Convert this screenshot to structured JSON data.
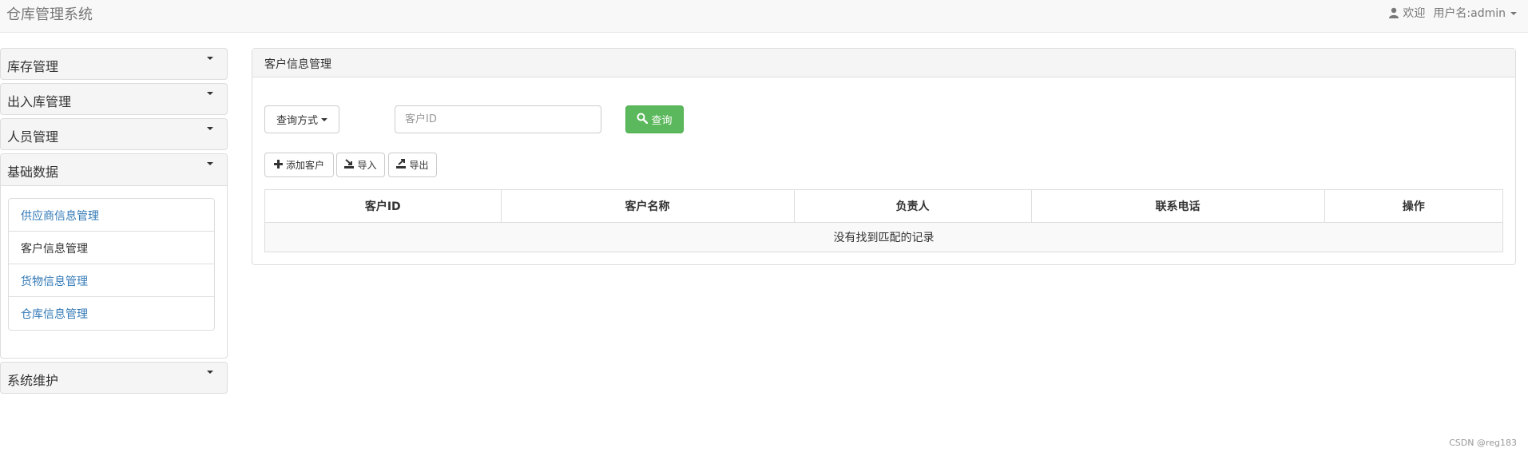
{
  "app": {
    "title": "仓库管理系统",
    "welcome": "欢迎",
    "user_label": "用户名:admin"
  },
  "sidebar": {
    "sections": [
      {
        "label": "库存管理"
      },
      {
        "label": "出入库管理"
      },
      {
        "label": "人员管理"
      },
      {
        "label": "基础数据",
        "open": true
      },
      {
        "label": "系统维护"
      }
    ],
    "sub_items": [
      {
        "label": "供应商信息管理"
      },
      {
        "label": "客户信息管理",
        "active": true
      },
      {
        "label": "货物信息管理"
      },
      {
        "label": "仓库信息管理"
      }
    ]
  },
  "main": {
    "panel_title": "客户信息管理",
    "query_mode_label": "查询方式",
    "search_placeholder": "客户ID",
    "search_value": "",
    "search_button": "查询",
    "add_button": "添加客户",
    "import_button": "导入",
    "export_button": "导出",
    "table": {
      "columns": [
        "客户ID",
        "客户名称",
        "负责人",
        "联系电话",
        "操作"
      ],
      "empty_text": "没有找到匹配的记录"
    }
  },
  "watermark": "CSDN @reg183",
  "colors": {
    "success": "#5cb85c",
    "link": "#337ab7",
    "navbar_bg": "#f8f8f8"
  },
  "icons": [
    "user-icon",
    "caret-down-icon",
    "search-icon",
    "plus-icon",
    "import-icon",
    "export-icon"
  ]
}
